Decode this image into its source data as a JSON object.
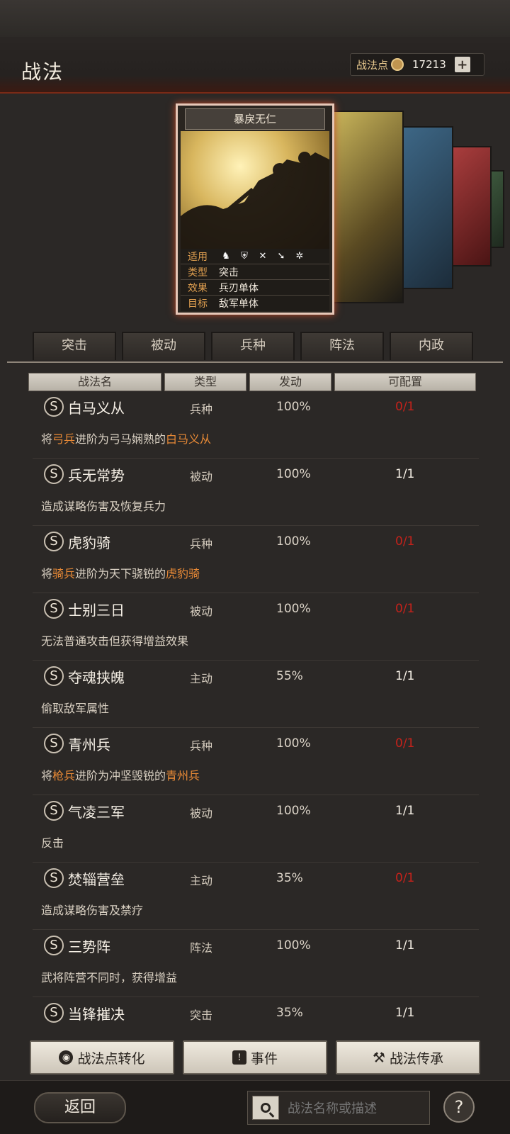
{
  "header": {
    "title": "战法",
    "points_label": "战法点",
    "points_value": "17213",
    "plus": "+"
  },
  "card": {
    "name": "暴戾无仁",
    "rows": [
      {
        "key": "适用",
        "value": ""
      },
      {
        "key": "类型",
        "value": "突击"
      },
      {
        "key": "效果",
        "value": "兵刃单体"
      },
      {
        "key": "目标",
        "value": "敌军单体"
      }
    ]
  },
  "tabs": [
    "突击",
    "被动",
    "兵种",
    "阵法",
    "内政"
  ],
  "columns": [
    "战法名",
    "类型",
    "发动",
    "可配置"
  ],
  "items": [
    {
      "badge": "S",
      "name": "白马义从",
      "type": "兵种",
      "rate": "100%",
      "config": "0/1",
      "config_red": true,
      "desc_parts": [
        "将",
        "弓兵",
        "进阶为弓马娴熟的",
        "白马义从"
      ]
    },
    {
      "badge": "S",
      "name": "兵无常势",
      "type": "被动",
      "rate": "100%",
      "config": "1/1",
      "config_red": false,
      "desc": "造成谋略伤害及恢复兵力"
    },
    {
      "badge": "S",
      "name": "虎豹骑",
      "type": "兵种",
      "rate": "100%",
      "config": "0/1",
      "config_red": true,
      "desc_parts": [
        "将",
        "骑兵",
        "进阶为天下骁锐的",
        "虎豹骑"
      ]
    },
    {
      "badge": "S",
      "name": "士别三日",
      "type": "被动",
      "rate": "100%",
      "config": "0/1",
      "config_red": true,
      "desc": "无法普通攻击但获得增益效果"
    },
    {
      "badge": "S",
      "name": "夺魂挟魄",
      "type": "主动",
      "rate": "55%",
      "config": "1/1",
      "config_red": false,
      "desc": "偷取敌军属性"
    },
    {
      "badge": "S",
      "name": "青州兵",
      "type": "兵种",
      "rate": "100%",
      "config": "0/1",
      "config_red": true,
      "desc_parts": [
        "将",
        "枪兵",
        "进阶为冲坚毁锐的",
        "青州兵"
      ]
    },
    {
      "badge": "S",
      "name": "气凌三军",
      "type": "被动",
      "rate": "100%",
      "config": "1/1",
      "config_red": false,
      "desc": "反击"
    },
    {
      "badge": "S",
      "name": "焚辎营垒",
      "type": "主动",
      "rate": "35%",
      "config": "0/1",
      "config_red": true,
      "desc": "造成谋略伤害及禁疗"
    },
    {
      "badge": "S",
      "name": "三势阵",
      "type": "阵法",
      "rate": "100%",
      "config": "1/1",
      "config_red": false,
      "desc": "武将阵营不同时，获得增益"
    },
    {
      "badge": "S",
      "name": "当锋摧决",
      "type": "突击",
      "rate": "35%",
      "config": "1/1",
      "config_red": false,
      "desc": ""
    }
  ],
  "buttons": {
    "convert": "战法点转化",
    "events": "事件",
    "inherit": "战法传承"
  },
  "bottom": {
    "back": "返回",
    "search_placeholder": "战法名称或描述",
    "help": "?"
  },
  "colors": {
    "accent_orange": "#e98a36",
    "red": "#c4221b",
    "card_glow": "#c04a2a"
  }
}
